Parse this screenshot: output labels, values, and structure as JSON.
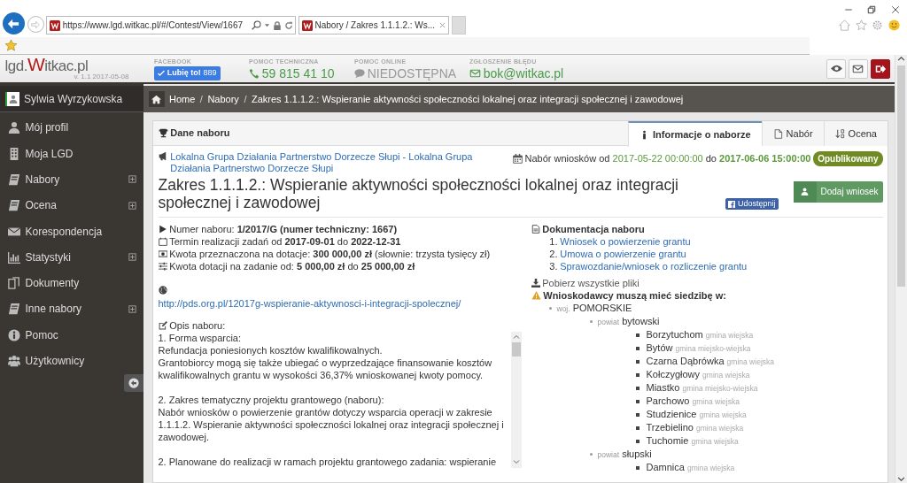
{
  "browser": {
    "url": "https://www.lgd.witkac.pl/#/Contest/View/1667",
    "tab_title": "Nabory / Zakres 1.1.1.2.: Ws..."
  },
  "header": {
    "logo": {
      "prefix": "lgd.",
      "accent": "W",
      "suffix": "itkac.pl"
    },
    "version": "v. 1.1 2017-05-08",
    "info": [
      {
        "kind": "facebook",
        "label": "FACEBOOK",
        "value": "Lubię to!",
        "count": "889"
      },
      {
        "kind": "phone",
        "label": "POMOC TECHNICZNA",
        "value": "59 815 41 10"
      },
      {
        "kind": "chat",
        "label": "POMOC ONLINE",
        "value": "NIEDOSTĘPNA"
      },
      {
        "kind": "mail",
        "label": "ZGŁOSZENIE BŁĘDU",
        "value": "bok@witkac.pl"
      }
    ]
  },
  "sidebar": {
    "user": "Sylwia Wyrzykowska",
    "items": [
      {
        "label": "Mój profil",
        "submenu": false
      },
      {
        "label": "Moja LGD",
        "submenu": false
      },
      {
        "label": "Nabory",
        "submenu": true
      },
      {
        "label": "Ocena",
        "submenu": true
      },
      {
        "label": "Korespondencja",
        "submenu": false
      },
      {
        "label": "Statystyki",
        "submenu": true
      },
      {
        "label": "Dokumenty",
        "submenu": false
      },
      {
        "label": "Inne nabory",
        "submenu": true
      },
      {
        "label": "Pomoc",
        "submenu": false
      },
      {
        "label": "Użytkownicy",
        "submenu": false
      }
    ]
  },
  "breadcrumb": {
    "separator": "/",
    "items": [
      "Home",
      "Nabory",
      "Zakres 1.1.1.2.: Wspieranie aktywności społeczności lokalnej oraz integracji społecznej i zawodowej"
    ]
  },
  "card": {
    "title": "Dane naboru",
    "tabs": [
      {
        "label": "Informacje o naborze",
        "selected": true
      },
      {
        "label": "Nabór",
        "selected": false
      },
      {
        "label": "Ocena",
        "selected": false
      }
    ]
  },
  "contest": {
    "organization": "Lokalna Grupa Działania Partnerstwo Dorzecze Słupi - Lokalna Grupa Działania Partnerstwo Dorzecze Słupi",
    "period": {
      "label": "Nabór wniosków od",
      "from": "2017-05-22 00:00:00",
      "to_word": "do",
      "to": "2017-06-06 15:00:00"
    },
    "status": "Opublikowany",
    "title": "Zakres 1.1.1.2.: Wspieranie aktywności społeczności lokalnej oraz integracji społecznej i zawodowej",
    "share": "Udostępnij",
    "add_button": "Dodaj wniosek",
    "facts": [
      "Numer naboru: **1/2017/G (numer techniczny: 1667)**",
      "Termin realizacji zadań od **2017-09-01** do **2022-12-31**",
      "Kwota przeznaczona na dotacje: **300 000,00 zł** (słownie: trzysta tysięcy zł)",
      "Kwota dotacji na zadanie od: **5 000,00 zł** do **25 000,00 zł**"
    ],
    "website": "http://pds.org.pl/12017g-wspieranie-aktywnosci-i-integracji-spolecznej/",
    "description_label": "Opis naboru:",
    "description": [
      [
        "1. Forma wsparcia:",
        "Refundacja poniesionych kosztów kwalifikowalnych.",
        "Grantobiorcy mogą się także ubiegać o wyprzedzające finansowanie kosztów kwalifikowalnych grantu w wysokości 36,37% wnioskowanej kwoty pomocy."
      ],
      [
        "2. Zakres tematyczny projektu grantowego (naboru):",
        "Nabór wniosków o powierzenie grantów dotyczy wsparcia operacji w zakresie 1.1.1.2. Wspieranie aktywności społeczności lokalnej oraz integracji społecznej i zawodowej."
      ],
      [
        "2. Planowane do realizacji w ramach projektu grantowego zadania: wspieranie"
      ]
    ],
    "docs_title": "Dokumentacja naboru",
    "docs": [
      {
        "number": "1.",
        "label": "Wniosek o powierzenie grantu"
      },
      {
        "number": "2.",
        "label": "Umowa o powierzenie grantu"
      },
      {
        "number": "3.",
        "label": "Sprawozdanie/wniosek o rozliczenie grantu"
      }
    ],
    "download": "Pobierz wszystkie pliki",
    "requirement": "Wnioskodawcy muszą mieć siedzibę w:",
    "regions": [
      {
        "prefix": "woj.",
        "name": "POMORSKIE",
        "children": [
          {
            "prefix": "powiat",
            "name": "bytowski",
            "children": [
              {
                "name": "Borzytuchom",
                "type": "gmina wiejska"
              },
              {
                "name": "Bytów",
                "type": "gmina miejsko-wiejska"
              },
              {
                "name": "Czarna Dąbrówka",
                "type": "gmina wiejska"
              },
              {
                "name": "Kołczygłowy",
                "type": "gmina wiejska"
              },
              {
                "name": "Miastko",
                "type": "gmina miejsko-wiejska"
              },
              {
                "name": "Parchowo",
                "type": "gmina wiejska"
              },
              {
                "name": "Studzienice",
                "type": "gmina wiejska"
              },
              {
                "name": "Trzebielino",
                "type": "gmina wiejska"
              },
              {
                "name": "Tuchomie",
                "type": "gmina wiejska"
              }
            ]
          },
          {
            "prefix": "powiat",
            "name": "słupski",
            "children": [
              {
                "name": "Damnica",
                "type": "gmina wiejska"
              }
            ]
          }
        ]
      }
    ]
  }
}
